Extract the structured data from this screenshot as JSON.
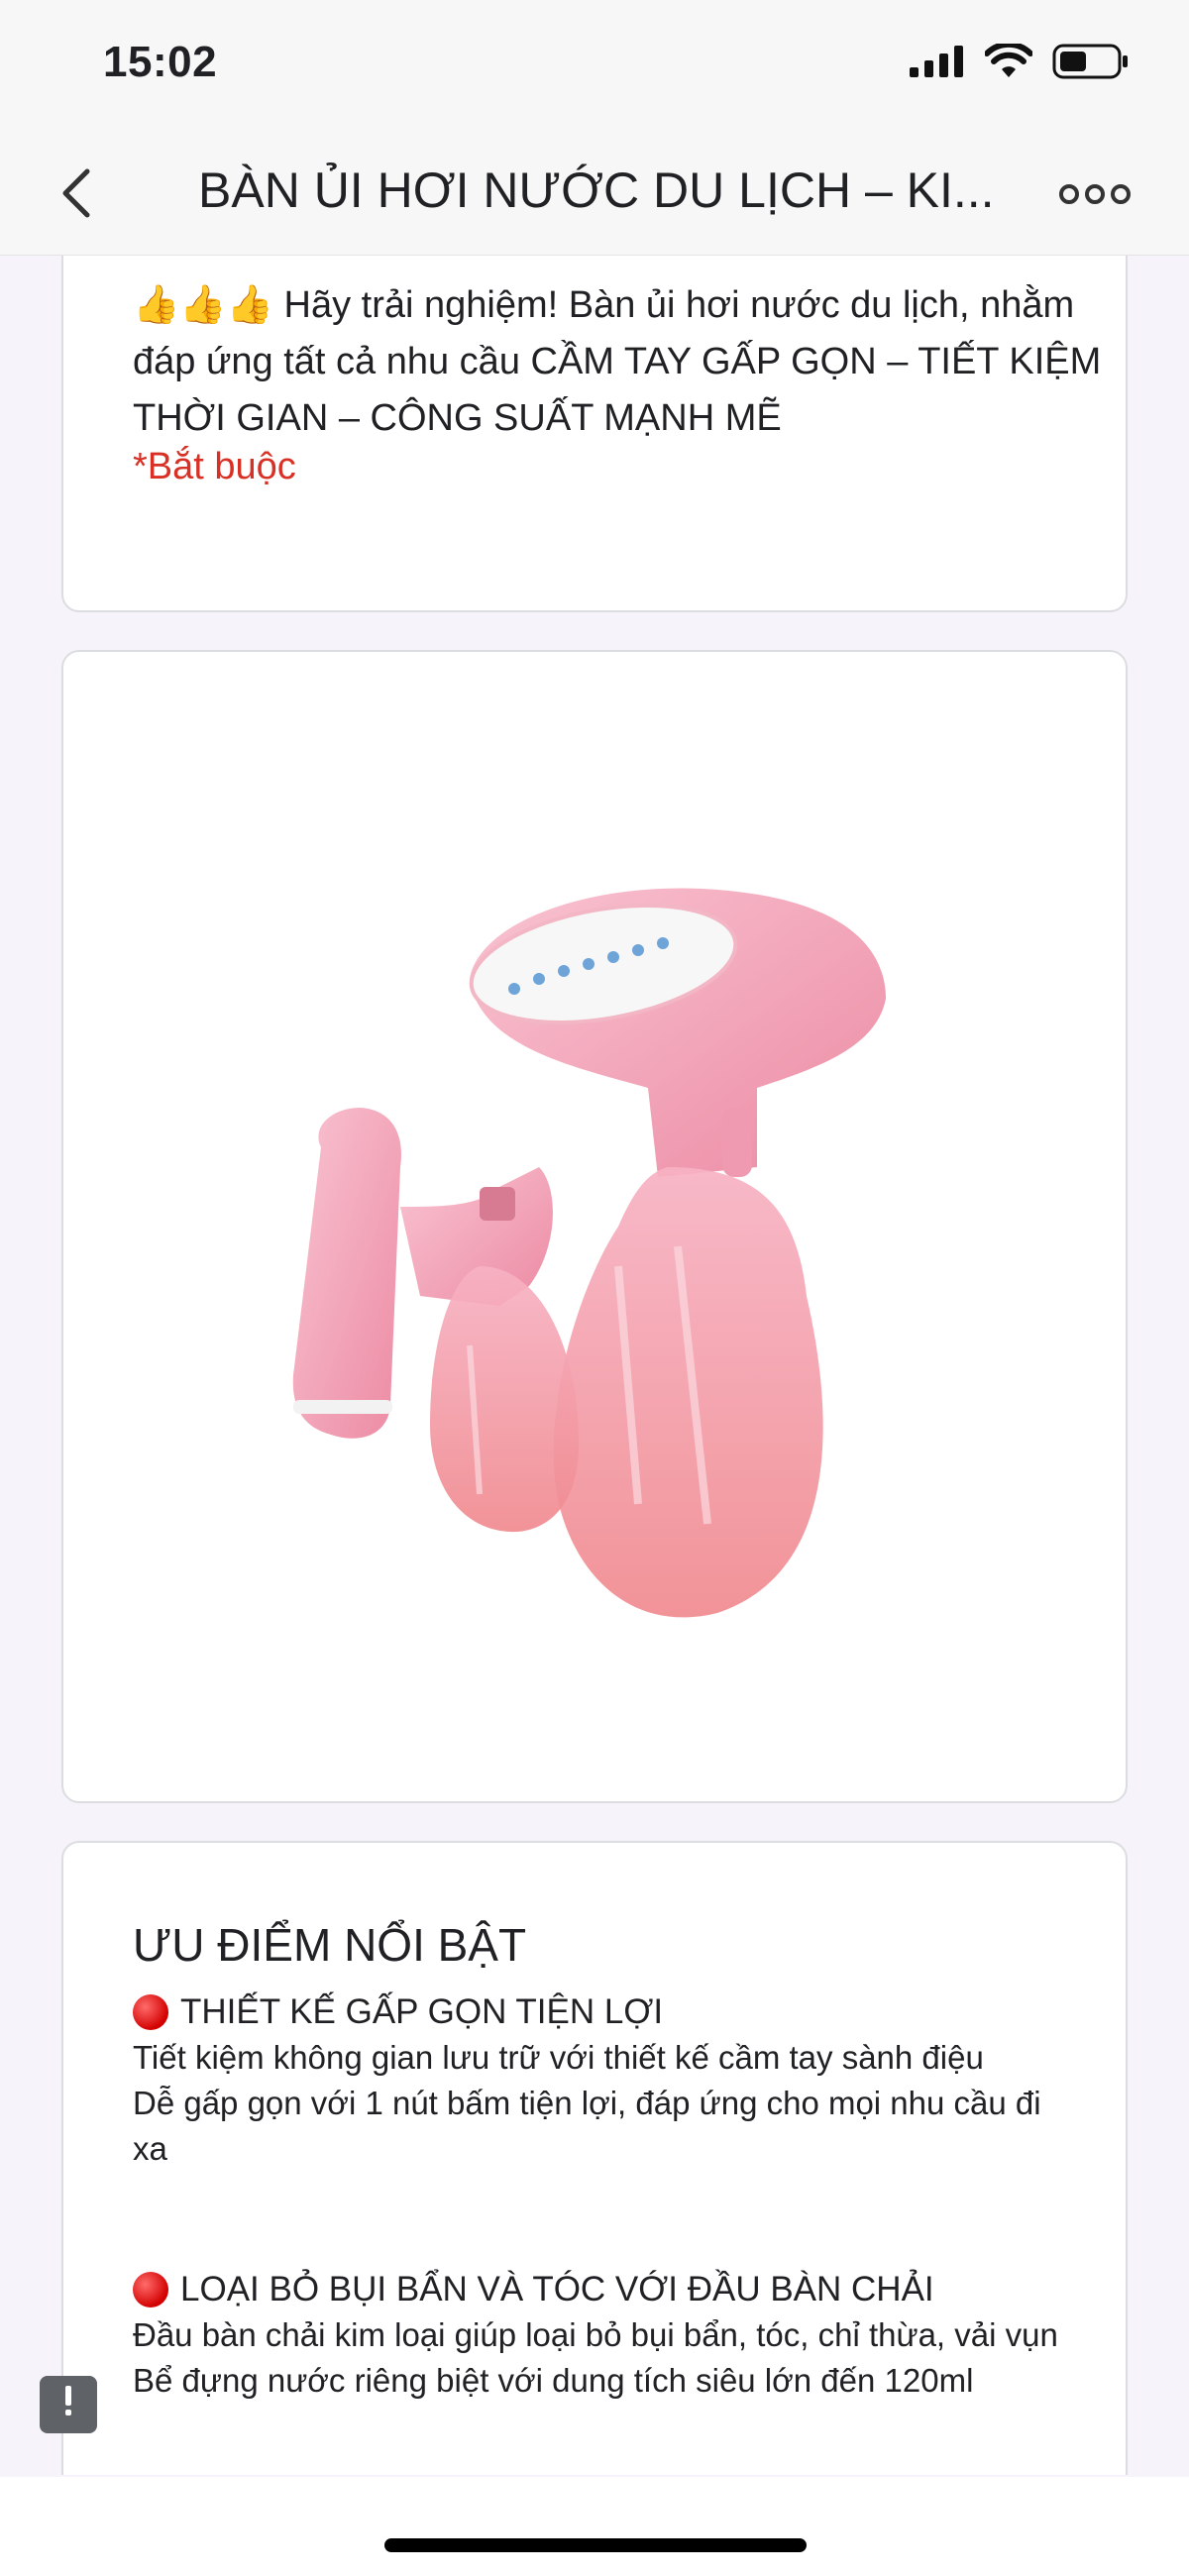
{
  "status_bar": {
    "time": "15:02",
    "icons": [
      "signal-icon",
      "wifi-icon",
      "battery-icon"
    ]
  },
  "header": {
    "title": "BÀN ỦI HƠI NƯỚC DU LỊCH – KI...",
    "back_icon": "chevron-left-icon",
    "more_icon": "more-dots-icon"
  },
  "intro": {
    "emoji": "👍👍👍",
    "text": "Hãy trải nghiệm! Bàn ủi hơi nước du lịch, nhằm đáp ứng tất cả nhu cầu CẦM TAY GẤP GỌN – TIẾT KIỆM THỜI GIAN – CÔNG SUẤT MẠNH MẼ",
    "required": "*Bắt buộc"
  },
  "product_image": {
    "subject": "pink handheld garment steamer, folded and unfolded"
  },
  "features": {
    "title": "ƯU ĐIỂM NỔI BẬT",
    "items": [
      {
        "heading": "THIẾT KẾ GẤP GỌN TIỆN LỢI",
        "lines": [
          "Tiết kiệm không gian lưu trữ với thiết kế cầm tay sành điệu",
          "Dễ gấp gọn với 1 nút bấm tiện lợi, đáp ứng cho mọi nhu cầu đi xa"
        ]
      },
      {
        "heading": "LOẠI BỎ BỤI BẨN VÀ TÓC VỚI ĐẦU BÀN CHẢI",
        "lines": [
          "Đầu bàn chải kim loại giúp loại bỏ bụi bẩn, tóc, chỉ thừa, vải vụn",
          "Bể đựng nước riêng biệt với dung tích siêu lớn đến 120ml"
        ]
      }
    ]
  },
  "colors": {
    "accent_red": "#d93025",
    "card_border": "#dcdde0",
    "page_bg": "#f7f3fa",
    "product_pink": "#f4a3b6"
  }
}
